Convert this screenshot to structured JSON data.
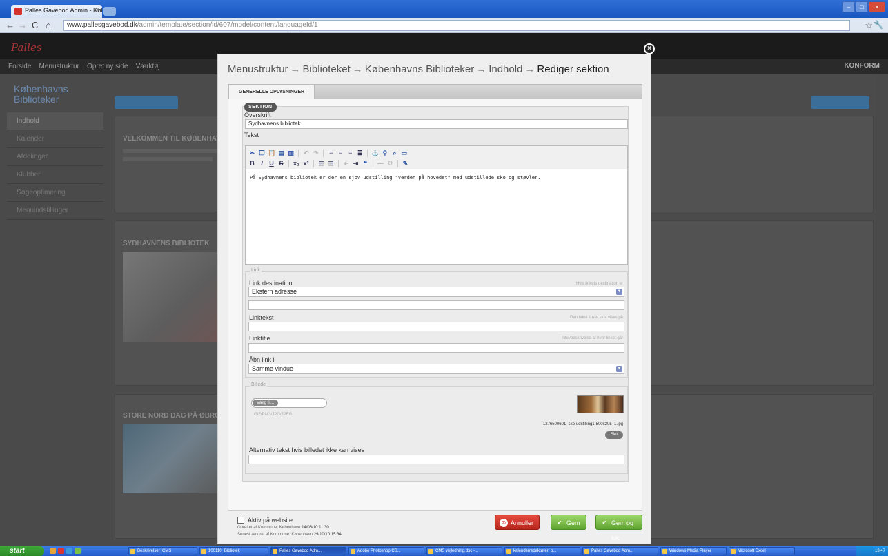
{
  "browser": {
    "tab_title": "Palles Gavebod Admin - Køben",
    "url_domain": "www.pallesgavebod.dk",
    "url_path": "/admin/template/section/id/607/model/content/languageId/1"
  },
  "app": {
    "logo": "Palles",
    "nav_items": [
      "Forside",
      "Menustruktur",
      "Opret ny side",
      "Værktøj"
    ],
    "nav_right": "KONFORM",
    "sidebar_title": "Københavns Biblioteker",
    "sidebar_items": [
      "Indhold",
      "Kalender",
      "Afdelinger",
      "Klubber",
      "Søgeoptimering",
      "Menuindstillinger"
    ],
    "bg_headings": [
      "VELKOMMEN TIL KØBENHAVN",
      "SYDHAVNENS BIBLIOTEK",
      "STORE NORD DAG PÅ ØBRO"
    ]
  },
  "modal": {
    "breadcrumb": [
      "Menustruktur",
      "Biblioteket",
      "Københavns Biblioteker",
      "Indhold"
    ],
    "breadcrumb_sep": "→",
    "breadcrumb_current": "Rediger sektion",
    "tab_label": "GENERELLE OPLYSNINGER",
    "section_badge": "SEKTION",
    "fields": {
      "overskrift_label": "Overskrift",
      "overskrift_value": "Sydhavnens bibliotek",
      "tekst_label": "Tekst",
      "tekst_value": "På Sydhavnens bibliotek er der en sjov udstilling \"Verden på hovedet\" med udstillede sko og støvler."
    },
    "link": {
      "legend": "Link",
      "destination_label": "Link destination",
      "destination_hint": "Hvis linkets destination er",
      "destination_value": "Ekstern adresse",
      "linktekst_label": "Linktekst",
      "linktekst_hint": "Den tekst linket skal vises på",
      "linktitle_label": "Linktitle",
      "linktitle_hint": "Titel/beskrivelse af hvor linket går",
      "open_label": "Åbn link i",
      "open_value": "Samme vindue"
    },
    "image": {
      "legend": "Billede",
      "upload_button": "Vælg fil...",
      "upload_formats": "GIF/PNG/JPG/JPEG",
      "filename": "1276500601_sko-udstilling1-500x205_1.jpg",
      "delete_button": "Slet",
      "alt_label": "Alternativ tekst hvis billedet ikke kan vises",
      "alt_value": ""
    },
    "footer": {
      "active_label": "Aktiv på website",
      "created_label": "Oprettet af Kommune: København",
      "created_date": "14/06/10 11:30",
      "modified_label": "Senest ændret af Kommune: København",
      "modified_date": "29/10/10 15:34",
      "cancel": "Annuller",
      "save": "Gem",
      "save_close": "Gem og luk"
    }
  },
  "taskbar": {
    "start": "start",
    "tasks": [
      "Beskrivelser_CMS",
      "100110_Bibliotek",
      "Palles Gavebod Adm...",
      "Adobe Photoshop CS...",
      "CMS vejledning.doc -...",
      "kalenderredaktører_b...",
      "Palles Gavebod Adm...",
      "Windows Media Player",
      "Microsoft Excel"
    ],
    "clock": "13:47"
  }
}
